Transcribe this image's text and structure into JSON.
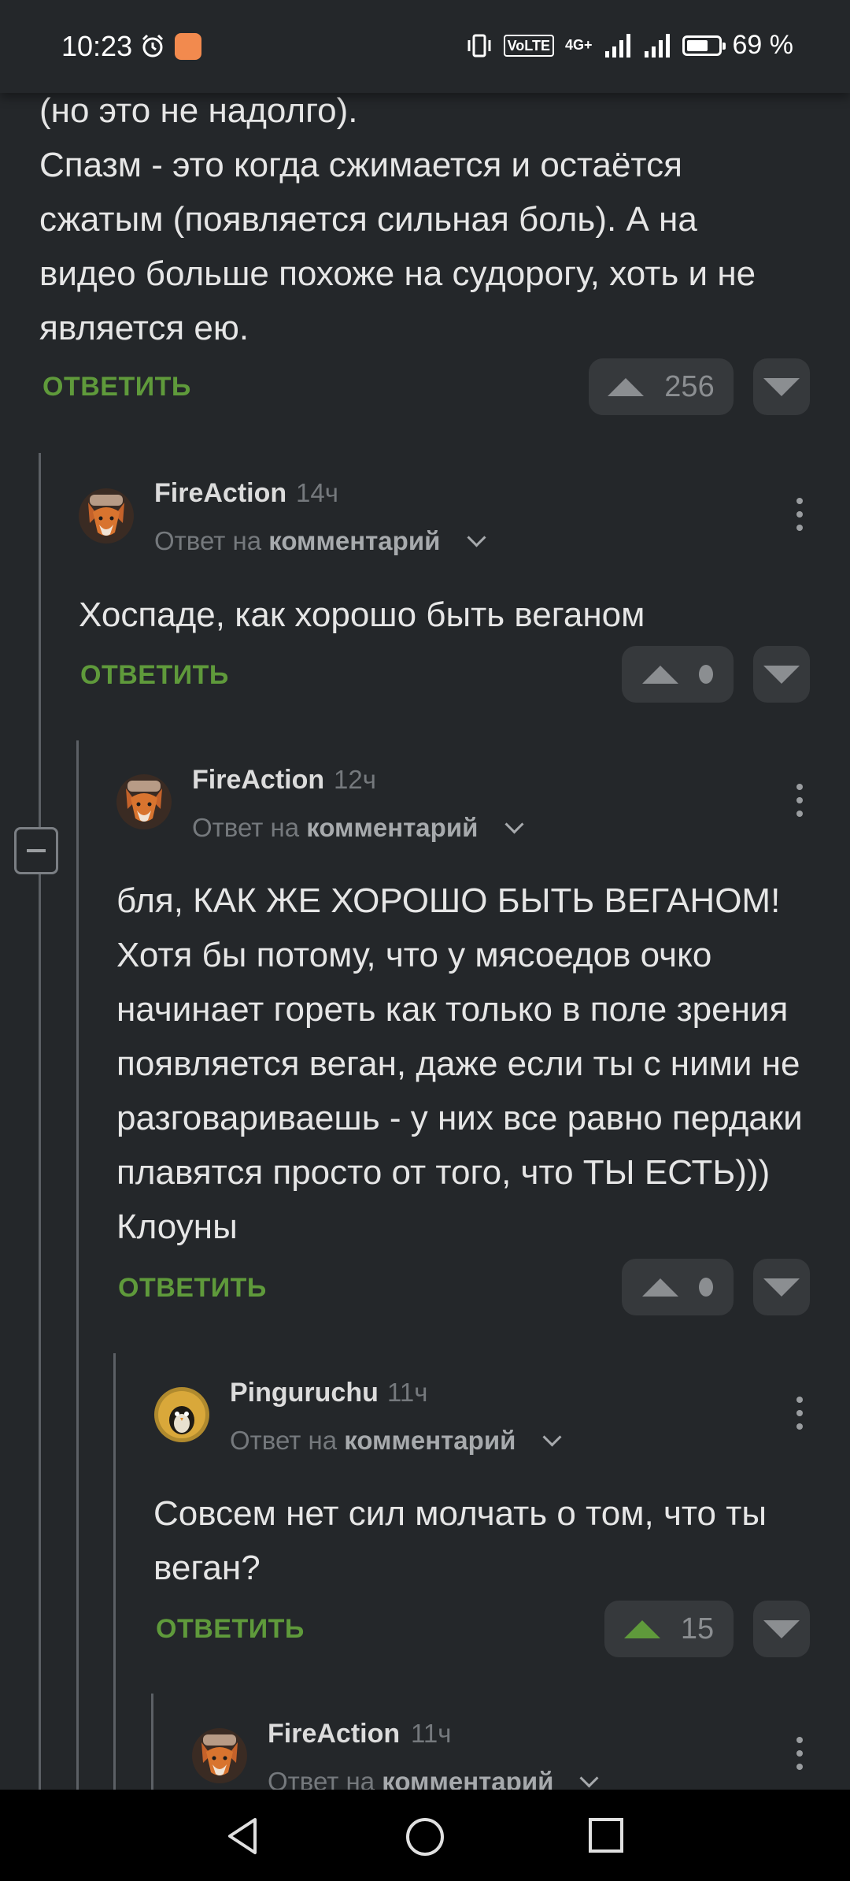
{
  "status_bar": {
    "time": "10:23",
    "network": "4G+",
    "volte": "VoLTE",
    "battery_percent": "69 %",
    "battery_level": 0.69,
    "icons": [
      "alarm-icon",
      "notification-icon",
      "vibrate-icon",
      "signal-icon",
      "battery-icon"
    ]
  },
  "top_comment": {
    "text_lines": "(но это не надолго).\nСпазм - это когда сжимается и остаётся сжатым (появляется сильная боль). А на видео больше похоже на судорогу, хоть и не является ею.",
    "reply_label": "ОТВЕТИТЬ",
    "votes": "256"
  },
  "comments": [
    {
      "author": "FireAction",
      "time": "14ч",
      "reply_prefix": "Ответ на",
      "reply_target": "комментарий",
      "text": "Хоспаде, как хорошо быть веганом",
      "reply_label": "ОТВЕТИТЬ"
    },
    {
      "author": "FireAction",
      "time": "12ч",
      "reply_prefix": "Ответ на",
      "reply_target": "комментарий",
      "text": "бля, КАК ЖЕ ХОРОШО БЫТЬ ВЕГАНОМ! Хотя бы потому, что у мясоедов очко начинает гореть как только в поле зрения появляется веган, даже если ты с ними не разговариваешь - у них все равно пердаки плавятся просто от того, что ТЫ ЕСТЬ))) Клоуны",
      "reply_label": "ОТВЕТИТЬ"
    },
    {
      "author": "Pinguruchu",
      "time": "11ч",
      "reply_prefix": "Ответ на",
      "reply_target": "комментарий",
      "text": "Совсем нет сил молчать о том, что ты веган?",
      "reply_label": "ОТВЕТИТЬ",
      "votes": "15"
    },
    {
      "author": "FireAction",
      "time": "11ч",
      "reply_prefix": "Ответ на",
      "reply_target": "комментарий"
    }
  ],
  "colors": {
    "background": "#24272a",
    "reply_green": "#5f9a3b",
    "vote_bg": "#36393c",
    "muted": "#75797d"
  }
}
